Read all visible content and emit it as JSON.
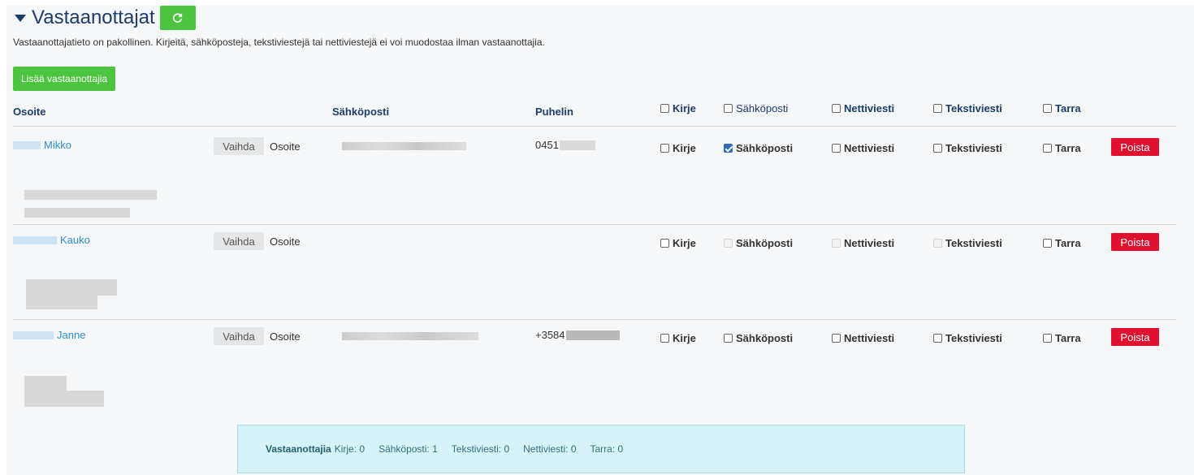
{
  "section": {
    "title": "Vastaanottajat",
    "notice": "Vastaanottajatieto on pakollinen. Kirjeitä, sähköposteja, tekstiviestejä tai nettiviestejä ei voi muodostaa ilman vastaanottajia.",
    "add_button": "Lisää vastaanottajia",
    "refresh_icon": "refresh-icon",
    "accent_color": "#4cc43f"
  },
  "table": {
    "headers": {
      "address": "Osoite",
      "email": "Sähköposti",
      "phone": "Puhelin",
      "letter": "Kirje",
      "email_check": "Sähköposti",
      "netmessage": "Nettiviesti",
      "sms": "Tekstiviesti",
      "label": "Tarra"
    },
    "rows": [
      {
        "name": "Mikko",
        "change_button": "Vaihda",
        "address_label": "Osoite",
        "phone": "0451",
        "letter": "Kirje",
        "letter_checked": false,
        "email_check": "Sähköposti",
        "email_checked": true,
        "netmessage": "Nettiviesti",
        "netmessage_checked": false,
        "sms": "Tekstiviesti",
        "sms_checked": false,
        "label": "Tarra",
        "label_checked": false,
        "delete_button": "Poista"
      },
      {
        "name": "Kauko",
        "change_button": "Vaihda",
        "address_label": "Osoite",
        "phone": "",
        "letter": "Kirje",
        "letter_checked": false,
        "email_check": "Sähköposti",
        "email_disabled": true,
        "netmessage": "Nettiviesti",
        "netmessage_disabled": true,
        "sms": "Tekstiviesti",
        "sms_disabled": true,
        "label": "Tarra",
        "label_checked": false,
        "delete_button": "Poista"
      },
      {
        "name": "Janne",
        "change_button": "Vaihda",
        "address_label": "Osoite",
        "phone": "+3584",
        "letter": "Kirje",
        "letter_checked": false,
        "email_check": "Sähköposti",
        "email_checked": false,
        "netmessage": "Nettiviesti",
        "netmessage_checked": false,
        "sms": "Tekstiviesti",
        "sms_checked": false,
        "label": "Tarra",
        "label_checked": false,
        "delete_button": "Poista"
      }
    ]
  },
  "summary": {
    "title": "Vastaanottajia",
    "letter": "Kirje: 0",
    "email": "Sähköposti: 1",
    "sms": "Tekstiviesti: 0",
    "netmessage": "Nettiviesti: 0",
    "label": "Tarra: 0"
  }
}
